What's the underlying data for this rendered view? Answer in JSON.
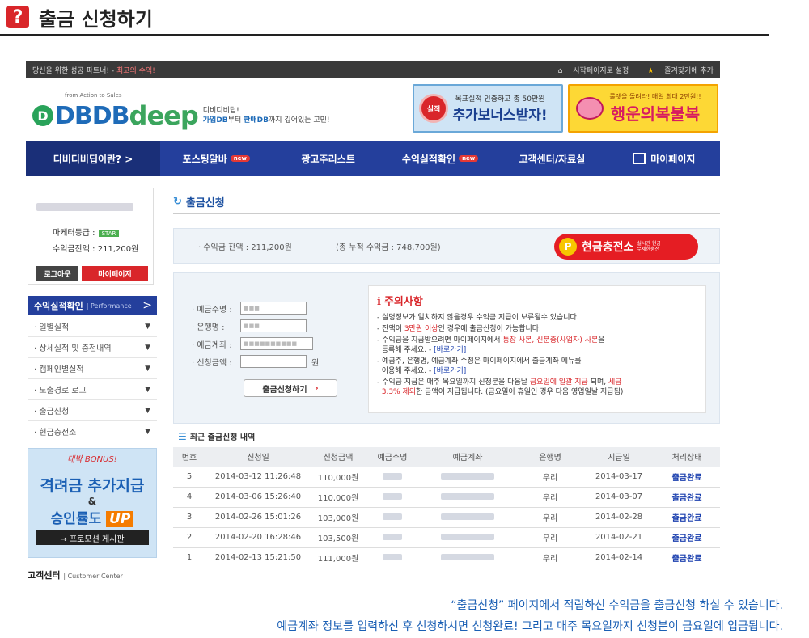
{
  "help": {
    "icon": "?",
    "title": "출금 신청하기"
  },
  "topbar": {
    "left_prefix": "당신을 위한 성공 파트너! - ",
    "left_highlight": "최고의 수익!",
    "home_link": "시작페이지로 설정",
    "fav_link": "즐겨찾기에 추가"
  },
  "logo": {
    "sub": "from Action to Sales",
    "ball": "D",
    "main": "DBDB",
    "deep": "deep",
    "tag_line1": "디비디비딥!",
    "tag_line2_bold": "가입DB",
    "tag_line2_mid": "부터 ",
    "tag_line2_bold2": "판매DB",
    "tag_line2_end": "까지 깊어있는 고민!"
  },
  "banners": {
    "b1_seal": "실적",
    "b1_line1": "목표실적 인증하고 총 50만원",
    "b1_line2": "추가보너스받자!",
    "b2_line1": "룰렛을 돌려라! 매일 최대 2만원!!",
    "b2_line2": "행운의복불복"
  },
  "nav": [
    {
      "label": "디비디비딥이란? >",
      "new": false
    },
    {
      "label": "포스팅알바",
      "new": true
    },
    {
      "label": "광고주리스트",
      "new": false
    },
    {
      "label": "수익실적확인",
      "new": true
    },
    {
      "label": "고객센터/자료실",
      "new": false
    },
    {
      "label": "마이페이지",
      "new": false
    }
  ],
  "new_badge": "new",
  "profile": {
    "grade_label": "마케터등급 :",
    "grade_badge": "STAR",
    "balance_label": "수익금잔액 : 211,200원",
    "logout": "로그아웃",
    "mypage": "마이페이지"
  },
  "perf": {
    "title": "수익실적확인",
    "sub": "Performance",
    "arrow": ">",
    "items": [
      "일별실적",
      "상세실적 및 충전내역",
      "캠페인별실적",
      "노출경로 로그",
      "출금신청",
      "현금충전소"
    ]
  },
  "bonus": {
    "line0": "대박 BONUS!",
    "line1": "격려금 추가지급",
    "line2": "&",
    "line3_a": "승인률도 ",
    "line3_b": "UP",
    "btn": "→ 프로모션 게시판"
  },
  "customer": {
    "title": "고객센터",
    "sub": "| Customer Center"
  },
  "main": {
    "title": "출금신청",
    "balance": "· 수익금 잔액 : 211,200원",
    "total": "(총 누적 수익금 : 748,700원)",
    "charge_p": "P",
    "charge_title": "현금충전소",
    "charge_sub1": "실시간 현금",
    "charge_sub2": "무제한충전"
  },
  "form": {
    "depositor_label": "· 예금주명 :",
    "bank_label": "· 은행명 :",
    "account_label": "· 예금계좌 :",
    "amount_label": "· 신청금액 :",
    "amount_unit": "원",
    "submit": "출금신청하기",
    "submit_arrow": "›"
  },
  "notice": {
    "icon": "i",
    "title": "주의사항",
    "l1": "- 실명정보가 일치하지 않을경우 수익금 지급이 보류될수 있습니다.",
    "l2_a": "- 잔액이 ",
    "l2_red": "3만원 이상",
    "l2_b": "인 경우에 출금신청이 가능합니다.",
    "l3_a": "- 수익금을 지급받으려면 마이페이지에서 ",
    "l3_red": "통장 사본, 신분증(사업자) 사본",
    "l3_b": "을",
    "l3_c": "등록해 주세요.  - ",
    "l3_link": "[바로가기]",
    "l4_a": "- 예금주, 은행명, 예금계좌 수정은 마이페이지에서 출금계좌 메뉴를",
    "l4_b": "이용해 주세요.  - ",
    "l4_link": "[바로가기]",
    "l5_a": "- 수익금 지급은 매주 목요일까지 신청분을 다음날 ",
    "l5_red": "금요일에 일괄 지급",
    "l5_b": " 되며, ",
    "l5_red2": "세금",
    "l5_red3": "3.3% 제외",
    "l5_c": "한 금액이 지급됩니다. (금요일이 휴일인 경우 다음 영업일날 지급됨)"
  },
  "history": {
    "title": "최근 출금신청 내역",
    "headers": [
      "번호",
      "신청일",
      "신청금액",
      "예금주명",
      "예금계좌",
      "은행명",
      "지급일",
      "처리상태"
    ],
    "rows": [
      {
        "no": "5",
        "date": "2014-03-12 11:26:48",
        "amount": "110,000원",
        "bank": "우리",
        "paid": "2014-03-17",
        "status": "출금완료"
      },
      {
        "no": "4",
        "date": "2014-03-06 15:26:40",
        "amount": "110,000원",
        "bank": "우리",
        "paid": "2014-03-07",
        "status": "출금완료"
      },
      {
        "no": "3",
        "date": "2014-02-26 15:01:26",
        "amount": "103,000원",
        "bank": "우리",
        "paid": "2014-02-28",
        "status": "출금완료"
      },
      {
        "no": "2",
        "date": "2014-02-20 16:28:46",
        "amount": "103,500원",
        "bank": "우리",
        "paid": "2014-02-21",
        "status": "출금완료"
      },
      {
        "no": "1",
        "date": "2014-02-13 15:21:50",
        "amount": "111,000원",
        "bank": "우리",
        "paid": "2014-02-14",
        "status": "출금완료"
      }
    ]
  },
  "caption": {
    "line1": "“출금신청”  페이지에서 적립하신 수익금을 출금신청 하실 수 있습니다.",
    "line2": "예금계좌 정보를 입력하신 후 신청하시면 신청완료! 그리고 매주 목요일까지 신청분이 금요일에 입금됩니다."
  }
}
